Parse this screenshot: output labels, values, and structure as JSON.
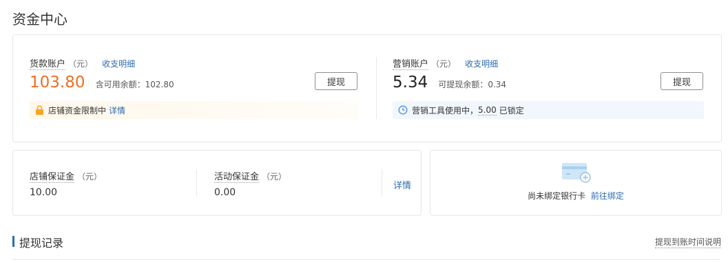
{
  "page": {
    "title": "资金中心"
  },
  "goods_account": {
    "label": "货款账户",
    "unit": "（元）",
    "detail_link": "收支明细",
    "amount": "103.80",
    "sub_label": "含可用余额：",
    "sub_value": "102.80",
    "withdraw_label": "提现",
    "notice_text": "店铺资金限制中",
    "notice_link": "详情"
  },
  "marketing_account": {
    "label": "营销账户",
    "unit": "（元）",
    "detail_link": "收支明细",
    "amount": "5.34",
    "sub_label": "可提现余额：",
    "sub_value": "0.34",
    "withdraw_label": "提现",
    "notice_prefix": "营销工具使用中，",
    "notice_amount": "5.00",
    "notice_suffix": "已锁定"
  },
  "deposits": {
    "shop_label": "店铺保证金",
    "shop_unit": "（元）",
    "shop_value": "10.00",
    "activity_label": "活动保证金",
    "activity_unit": "（元）",
    "activity_value": "0.00",
    "detail_link": "详情"
  },
  "bank": {
    "text": "尚未绑定银行卡",
    "link": "前往绑定"
  },
  "records": {
    "title": "提现记录",
    "help_link": "提现到账时间说明"
  },
  "colors": {
    "accent": "#2c6cb0",
    "amount_highlight": "#ed6f21",
    "lock": "#f5a623",
    "clock": "#4a90d9"
  },
  "icons": {
    "lock": "lock-icon",
    "clock": "clock-icon",
    "bank_card": "bank-card-add-icon"
  }
}
